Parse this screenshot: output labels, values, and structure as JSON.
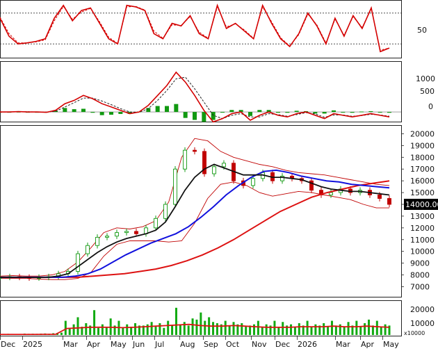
{
  "chart_data": {
    "type": "candlestick",
    "x_labels": [
      "Dec",
      "2025",
      "Mar",
      "Apr",
      "May",
      "Jun",
      "Jul",
      "Aug",
      "Sep",
      "Oct",
      "Nov",
      "Dec",
      "2026",
      "Mar",
      "Apr",
      "May"
    ],
    "panels": {
      "oscillator": {
        "y_ticks": [
          "50"
        ],
        "dashed_levels": [
          80,
          20
        ],
        "series": [
          {
            "color": "#d40000",
            "style": "solid",
            "values": [
              70,
              35,
              20,
              22,
              25,
              30,
              70,
              95,
              65,
              85,
              90,
              60,
              30,
              20,
              95,
              92,
              85,
              40,
              30,
              60,
              55,
              75,
              40,
              30,
              95,
              50,
              60,
              45,
              30,
              95,
              60,
              30,
              15,
              40,
              80,
              55,
              20,
              70,
              35,
              75,
              50,
              90,
              5,
              12
            ]
          },
          {
            "color": "#d40000",
            "style": "dashed",
            "values": [
              72,
              40,
              22,
              22,
              24,
              28,
              65,
              93,
              68,
              82,
              89,
              63,
              33,
              21,
              92,
              93,
              86,
              45,
              31,
              57,
              56,
              73,
              43,
              31,
              92,
              53,
              59,
              47,
              31,
              92,
              63,
              32,
              16,
              38,
              78,
              57,
              22,
              68,
              37,
              73,
              52,
              88,
              8,
              12
            ]
          }
        ]
      },
      "macd": {
        "y_ticks": [
          "1000",
          "500",
          "0"
        ],
        "ylim": [
          -250,
          1450
        ],
        "macd": [
          0,
          0,
          10,
          0,
          0,
          -10,
          50,
          250,
          350,
          500,
          400,
          250,
          150,
          50,
          -50,
          0,
          200,
          500,
          800,
          1200,
          900,
          500,
          50,
          -300,
          -200,
          -50,
          0,
          -250,
          -100,
          0,
          -100,
          -150,
          -50,
          0,
          -100,
          -200,
          -50,
          -100,
          -150,
          -100,
          -50,
          -100,
          -150
        ],
        "signal": [
          0,
          0,
          5,
          5,
          0,
          -5,
          20,
          150,
          280,
          420,
          420,
          330,
          220,
          100,
          0,
          -10,
          100,
          350,
          650,
          1000,
          1050,
          700,
          300,
          -100,
          -200,
          -100,
          -50,
          -150,
          -150,
          -50,
          -80,
          -130,
          -80,
          -20,
          -60,
          -160,
          -90,
          -90,
          -130,
          -110,
          -70,
          -90,
          -130
        ],
        "histogram_color": "#119911"
      },
      "price": {
        "y_ticks": [
          "20000",
          "19000",
          "18000",
          "17000",
          "16000",
          "15000",
          "14000",
          "13000",
          "12000",
          "11000",
          "10000",
          "9000",
          "8000",
          "7000"
        ],
        "ylim": [
          6200,
          20500
        ],
        "last_price_label": "14000.00",
        "close": [
          7800,
          7850,
          7800,
          7750,
          7800,
          7850,
          8100,
          8300,
          9800,
          10500,
          11200,
          11300,
          11600,
          11700,
          11500,
          12000,
          12800,
          14000,
          17000,
          18600,
          18500,
          16600,
          17200,
          17500,
          16000,
          15600,
          16200,
          16700,
          16000,
          16400,
          16200,
          16000,
          15200,
          14800,
          15000,
          15300,
          15000,
          15200,
          14800,
          14500,
          14000
        ],
        "ma_black": [
          7800,
          7800,
          7800,
          7790,
          7790,
          7800,
          7900,
          8100,
          8700,
          9300,
          9900,
          10400,
          10800,
          11100,
          11300,
          11500,
          11800,
          12500,
          13800,
          15200,
          16300,
          17000,
          17400,
          17100,
          16800,
          16500,
          16500,
          16500,
          16300,
          16300,
          16200,
          16100,
          15800,
          15500,
          15300,
          15200,
          15100,
          15100,
          15000,
          14900,
          14800
        ],
        "ma_blue": [
          7800,
          7800,
          7800,
          7800,
          7800,
          7800,
          7900,
          8100,
          8500,
          9100,
          9700,
          10200,
          10700,
          11100,
          11500,
          12100,
          12900,
          13800,
          14800,
          15600,
          16300,
          16800,
          16900,
          16700,
          16400,
          16200,
          16000,
          15900,
          15700,
          15600,
          15500,
          15400
        ],
        "ma_red": [
          7800,
          7800,
          7800,
          7800,
          7800,
          7800,
          7900,
          8000,
          8100,
          8300,
          8500,
          8800,
          9200,
          9700,
          10300,
          11000,
          11800,
          12600,
          13400,
          14000,
          14600,
          15000,
          15300,
          15600,
          15800,
          16000
        ],
        "bb_upper": [
          7900,
          7950,
          7900,
          7900,
          8000,
          8300,
          9100,
          10300,
          11600,
          12000,
          11900,
          12100,
          12600,
          14200,
          18000,
          19600,
          19400,
          18500,
          18000,
          17700,
          17400,
          17200,
          16900,
          16700,
          16600,
          16500,
          16300,
          16100,
          15900,
          15700,
          15600
        ],
        "bb_lower": [
          7700,
          7700,
          7700,
          7650,
          7600,
          7600,
          7700,
          8200,
          9600,
          10600,
          10900,
          10900,
          10900,
          10800,
          10900,
          12400,
          14500,
          15700,
          15900,
          15600,
          15000,
          14700,
          14900,
          15100,
          15000,
          14800,
          14600,
          14400,
          14000,
          13700,
          13700
        ]
      },
      "volume": {
        "y_ticks": [
          "20000",
          "10000"
        ],
        "unit": "x10000",
        "ylim": [
          0,
          27000
        ],
        "ma_red": [
          500,
          500,
          500,
          500,
          600,
          600,
          5500,
          6000,
          6500,
          6600,
          6500,
          6200,
          6500,
          7000,
          7500,
          8000,
          8500,
          9000,
          8000,
          7500,
          7500,
          8000,
          7500,
          7000,
          6500,
          6500,
          6500,
          7000,
          7000,
          7000,
          7500,
          7000,
          7000,
          7500,
          7000,
          6500
        ],
        "bars": [
          800,
          900,
          1000,
          900,
          800,
          900,
          1200,
          1000,
          1100,
          1000,
          1200,
          1300,
          1100,
          1500,
          1700,
          2000,
          12000,
          6000,
          9000,
          15000,
          7000,
          10000,
          8000,
          21000,
          6000,
          9000,
          7000,
          14000,
          8000,
          12000,
          6000,
          9000,
          7000,
          10000,
          8000,
          8000,
          9000,
          11000,
          7000,
          10000,
          6000,
          12000,
          8000,
          23000,
          9000,
          11000,
          8000,
          14000,
          13000,
          19000,
          12000,
          15000,
          11000,
          10000,
          9000,
          12000,
          8000,
          11000,
          9000,
          10000,
          7000,
          8000,
          9000,
          12000,
          7000,
          9000,
          8000,
          12000,
          7000,
          11000,
          8000,
          9000,
          7000,
          10000,
          8000,
          12000,
          7000,
          9000,
          8000,
          10000,
          7000,
          12000,
          8000,
          9000,
          7000,
          11000,
          8000,
          12000,
          7000,
          10000,
          13000,
          8000,
          12000,
          7000,
          9000,
          8000
        ]
      }
    }
  }
}
